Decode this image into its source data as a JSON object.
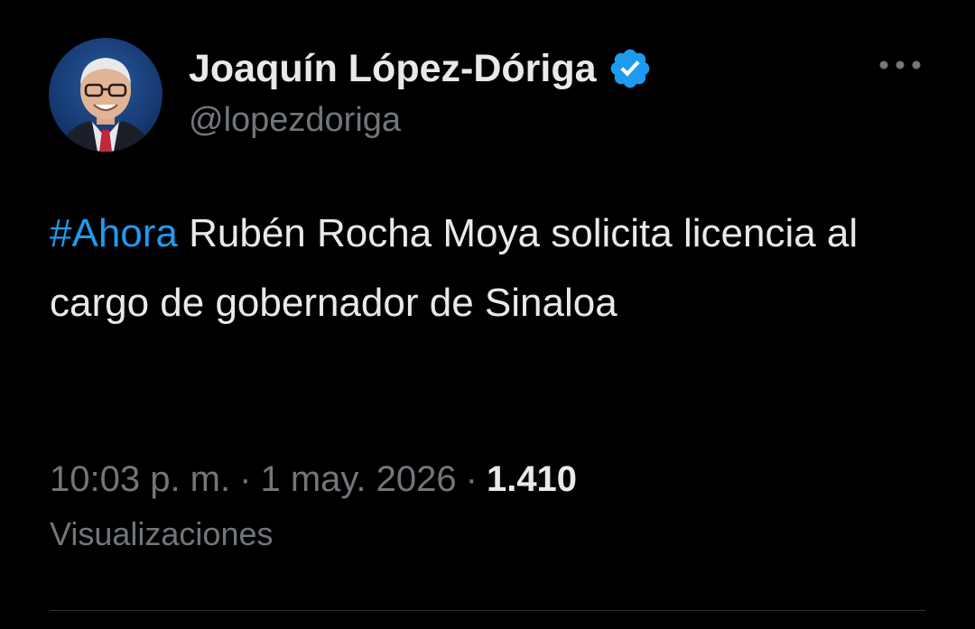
{
  "author": {
    "display_name": "Joaquín López-Dóriga",
    "handle": "@lopezdoriga",
    "verified": true
  },
  "tweet": {
    "hashtag": "#Ahora",
    "text": " Rubén Rocha Moya solicita licencia al cargo de gobernador de Sinaloa"
  },
  "meta": {
    "time": "10:03 p. m.",
    "separator": "·",
    "date": "1 may. 2026",
    "views_count": "1.410",
    "views_label": "Visualizaciones"
  },
  "icons": {
    "verified": "verified-badge-icon",
    "more": "more-options-icon"
  },
  "colors": {
    "background": "#000000",
    "text": "#e7e9ea",
    "secondary": "#71767b",
    "accent": "#1d9bf0",
    "divider": "#2f3336"
  }
}
